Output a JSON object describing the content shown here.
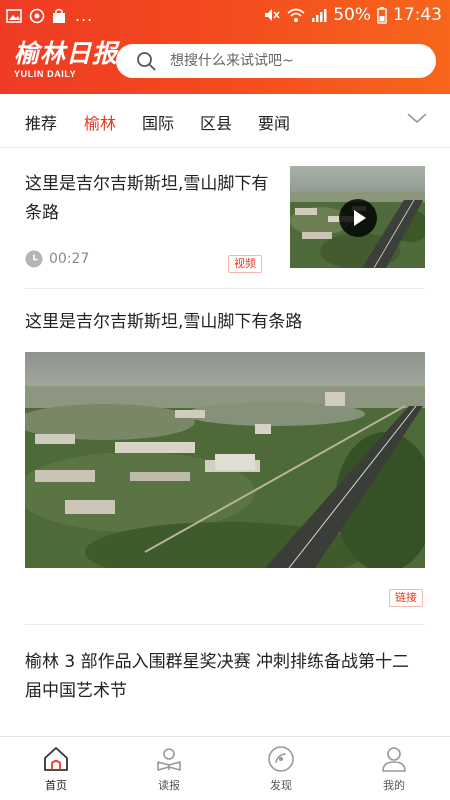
{
  "status_bar": {
    "dots": "...",
    "battery": "50%",
    "time": "17:43"
  },
  "header": {
    "logo_text": "榆林日报",
    "logo_subtext": "YULIN DAILY"
  },
  "search": {
    "placeholder": "想搜什么来试试吧~"
  },
  "tabs": [
    {
      "label": "推荐",
      "active": false
    },
    {
      "label": "榆林",
      "active": true
    },
    {
      "label": "国际",
      "active": false
    },
    {
      "label": "区县",
      "active": false
    },
    {
      "label": "要闻",
      "active": false
    }
  ],
  "feed": {
    "items": [
      {
        "title": "这里是吉尔吉斯斯坦,雪山脚下有条路",
        "duration": "00:27",
        "tag": "视频"
      },
      {
        "title": "这里是吉尔吉斯斯坦,雪山脚下有条路",
        "tag": "链接"
      },
      {
        "title": "榆林 3 部作品入围群星奖决赛 冲刺排练备战第十二届中国艺术节"
      }
    ]
  },
  "bottom_nav": [
    {
      "label": "首页",
      "icon": "home-icon",
      "active": true
    },
    {
      "label": "读报",
      "icon": "newspaper-icon",
      "active": false
    },
    {
      "label": "发现",
      "icon": "compass-icon",
      "active": false
    },
    {
      "label": "我的",
      "icon": "profile-icon",
      "active": false
    }
  ],
  "colors": {
    "accent": "#e8381f",
    "header_start": "#ef3b24",
    "header_end": "#f7661c"
  }
}
